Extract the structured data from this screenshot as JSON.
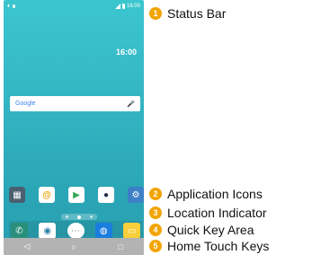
{
  "phone": {
    "status_bar": {
      "time": "16:00"
    },
    "home": {
      "clock": "16:00"
    },
    "search": {
      "logo": "Google"
    },
    "apps": [
      "app-grid-icon",
      "email-icon",
      "play-store-icon",
      "camera-icon",
      "settings-icon"
    ],
    "quick_keys": [
      "phone-icon",
      "contacts-icon",
      "apps-icon",
      "browser-icon",
      "message-icon"
    ],
    "nav_keys": [
      "back-icon",
      "home-icon",
      "recents-icon"
    ]
  },
  "labels": [
    {
      "num": "1",
      "text": "Status Bar"
    },
    {
      "num": "2",
      "text": "Application Icons"
    },
    {
      "num": "3",
      "text": "Location Indicator"
    },
    {
      "num": "4",
      "text": "Quick Key Area"
    },
    {
      "num": "5",
      "text": "Home Touch Keys"
    }
  ],
  "colors": {
    "badge": "#f2a400",
    "screen": "#33b3c1",
    "navbar": "#b3b3b3"
  }
}
